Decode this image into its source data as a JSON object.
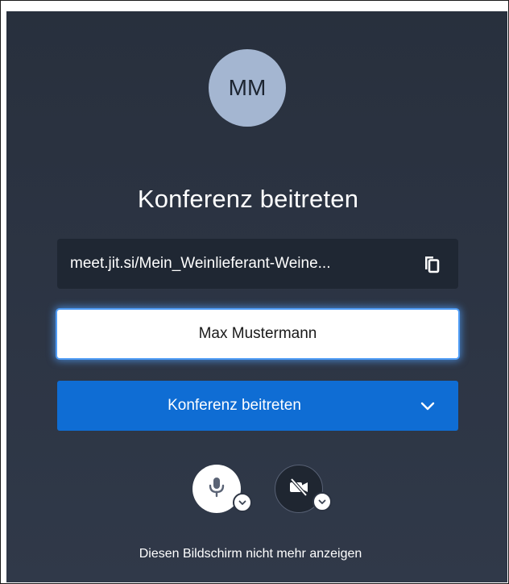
{
  "avatar": {
    "initials": "MM"
  },
  "title": "Konferenz beitreten",
  "meeting_url": {
    "text": "meet.jit.si/Mein_Weinlieferant-Weine...",
    "copy_icon": "copy-icon"
  },
  "name_input": {
    "value": "Max Mustermann"
  },
  "join_button": {
    "label": "Konferenz beitreten",
    "chevron_icon": "chevron-down-icon"
  },
  "media": {
    "mic_icon": "microphone-icon",
    "camera_icon": "camera-off-icon"
  },
  "footer": {
    "dont_show_again": "Diesen Bildschirm nicht mehr anzeigen"
  },
  "colors": {
    "background": "#2c3443",
    "accent": "#0f6dd4",
    "avatar_bg": "#a4b6d1",
    "focus_glow": "#4f9cf5"
  }
}
